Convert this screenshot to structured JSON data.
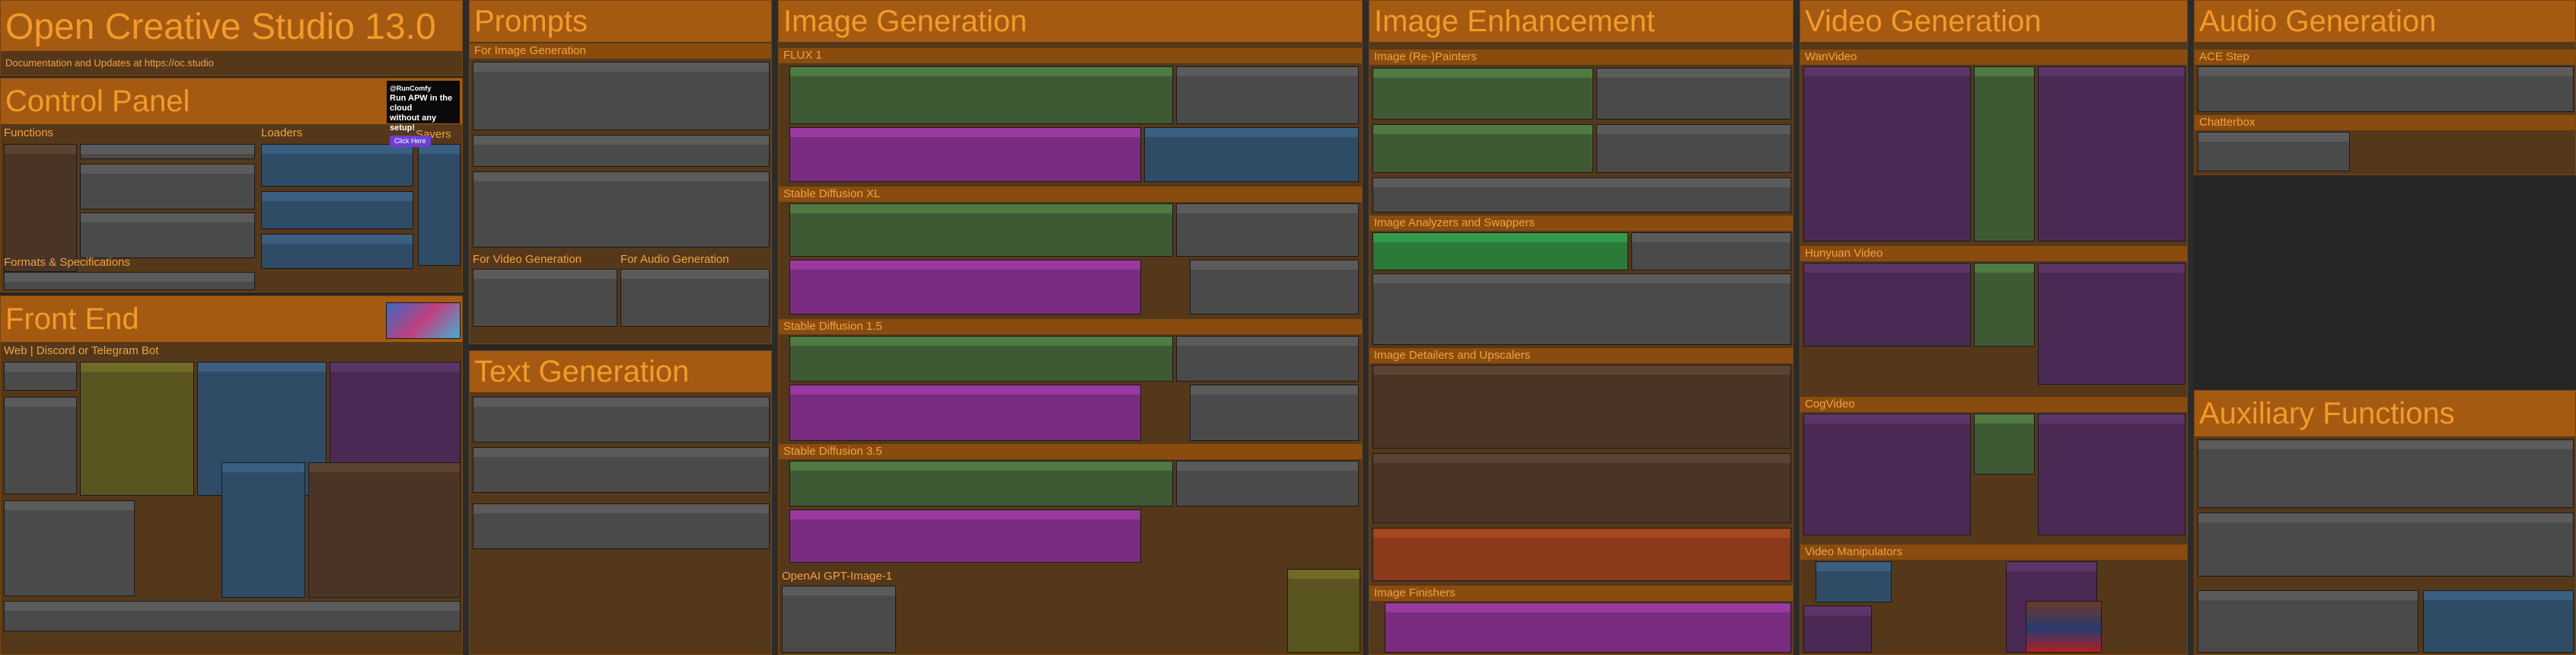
{
  "studio": {
    "title": "Open Creative Studio 13.0",
    "tagline": "Documentation and Updates at https://oc.studio"
  },
  "control_panel": {
    "title": "Control Panel",
    "functions": "Functions",
    "loaders": "Loaders",
    "formats": "Formats & Specifications",
    "savers": "Savers"
  },
  "ad": {
    "handle": "@RunComfy",
    "line1": "Run APW in the cloud",
    "line2": "without any setup!",
    "button": "Click Here"
  },
  "front_end": {
    "title": "Front End",
    "subtitle": "Web | Discord or Telegram Bot"
  },
  "prompts": {
    "title": "Prompts",
    "image_gen": "For Image Generation",
    "video_gen": "For Video Generation",
    "audio_gen": "For Audio Generation"
  },
  "text_gen": {
    "title": "Text Generation"
  },
  "image_gen": {
    "title": "Image Generation",
    "flux": "FLUX 1",
    "sdxl": "Stable Diffusion XL",
    "sd15": "Stable Diffusion 1.5",
    "sd35": "Stable Diffusion 3.5",
    "openai": "OpenAI GPT-Image-1"
  },
  "enhance": {
    "title": "Image Enhancement",
    "painters": "Image (Re-)Painters",
    "analyzers": "Image Analyzers and Swappers",
    "detailers": "Image Detailers and Upscalers",
    "finishers": "Image Finishers"
  },
  "video": {
    "title": "Video Generation",
    "wan": "WanVideo",
    "hunyuan": "Hunyuan Video",
    "cog": "CogVideo",
    "manip": "Video Manipulators"
  },
  "audio": {
    "title": "Audio Generation",
    "ace": "ACE Step",
    "chatterbox": "Chatterbox"
  },
  "aux": {
    "title": "Auxiliary Functions"
  }
}
